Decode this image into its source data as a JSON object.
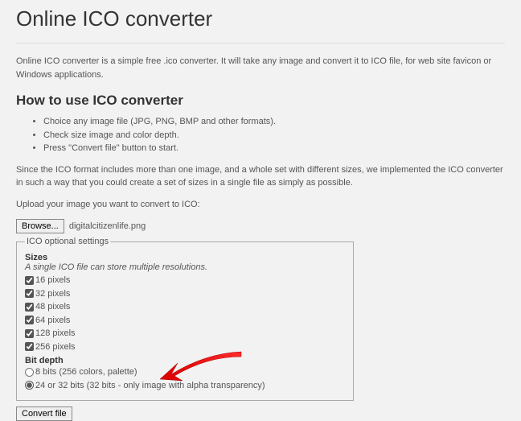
{
  "title": "Online ICO converter",
  "intro": "Online ICO converter is a simple free .ico converter. It will take any image and convert it to ICO file, for web site favicon or Windows applications.",
  "howto_heading": "How to use ICO converter",
  "steps": [
    "Choice any image file (JPG, PNG, BMP and other formats).",
    "Check size image and color depth.",
    "Press \"Convert file\" button to start."
  ],
  "paragraph": "Since the ICO format includes more than one image, and a whole set with different sizes, we implemented the ICO converter in such a way that you could create a set of sizes in a single file as simply as possible.",
  "upload_label": "Upload your image you want to convert to ICO:",
  "browse_label": "Browse...",
  "filename": "digitalcitizenlife.png",
  "fieldset_legend": "ICO optional settings",
  "sizes_heading": "Sizes",
  "sizes_sub": "A single ICO file can store multiple resolutions.",
  "sizes": [
    {
      "label": "16 pixels",
      "checked": true
    },
    {
      "label": "32 pixels",
      "checked": true
    },
    {
      "label": "48 pixels",
      "checked": true
    },
    {
      "label": "64 pixels",
      "checked": true
    },
    {
      "label": "128 pixels",
      "checked": true
    },
    {
      "label": "256 pixels",
      "checked": true
    }
  ],
  "bitdepth_heading": "Bit depth",
  "bitdepths": [
    {
      "label": "8 bits (256 colors, palette)",
      "selected": false
    },
    {
      "label": "24 or 32 bits (32 bits - only image with alpha transparency)",
      "selected": true
    }
  ],
  "convert_label": "Convert file"
}
